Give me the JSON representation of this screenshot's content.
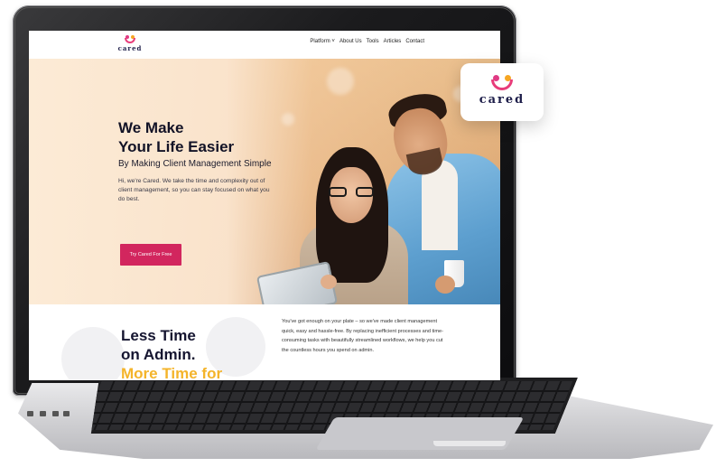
{
  "brand": {
    "name": "cared",
    "colors": {
      "pink": "#e03a84",
      "orange": "#f6a623",
      "navy": "#1e1e4a",
      "cta": "#d2265e",
      "accent_yellow": "#f4b42a"
    }
  },
  "nav": {
    "items": [
      "Platform ˅",
      "About Us",
      "Tools",
      "Articles",
      "Contact"
    ]
  },
  "hero": {
    "title": "We Make\nYour Life Easier",
    "subtitle": "By Making Client Management Simple",
    "body": "Hi, we're Cared. We take the time and complexity out of client management, so you can stay focused on what you do best.",
    "cta_label": "Try Cared For Free"
  },
  "section2": {
    "title": "Less Time\non Admin.",
    "title_accent": "More Time for",
    "body": "You've got enough on your plate – so we've made client management quick, easy and hassle-free. By replacing inefficient processes and time-consuming tasks with beautifully streamlined workflows, we help you cut the countless hours you spend on admin."
  },
  "icons": [
    "cared-logo-icon"
  ]
}
